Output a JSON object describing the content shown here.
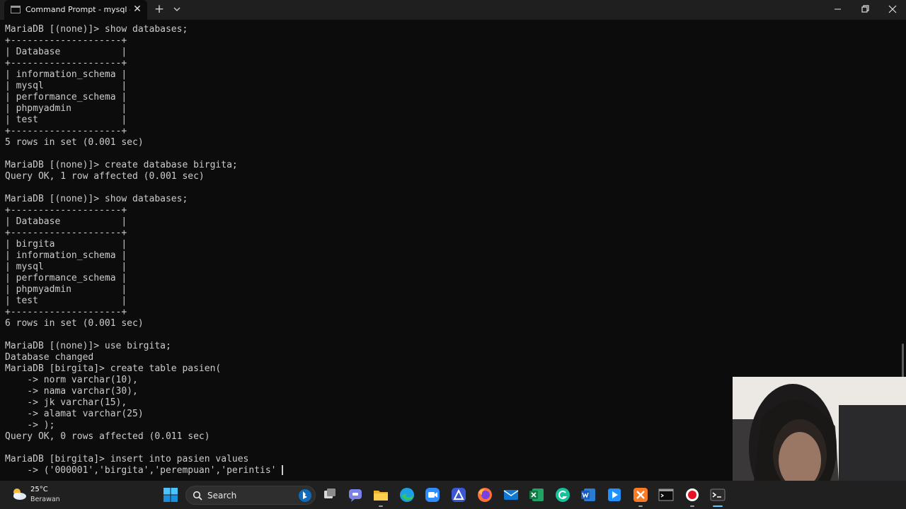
{
  "window": {
    "tab_title": "Command Prompt - mysql -u",
    "tab_close": "✕",
    "new_tab": "+"
  },
  "terminal": {
    "lines": [
      "MariaDB [(none)]> show databases;",
      "+--------------------+",
      "| Database           |",
      "+--------------------+",
      "| information_schema |",
      "| mysql              |",
      "| performance_schema |",
      "| phpmyadmin         |",
      "| test               |",
      "+--------------------+",
      "5 rows in set (0.001 sec)",
      "",
      "MariaDB [(none)]> create database birgita;",
      "Query OK, 1 row affected (0.001 sec)",
      "",
      "MariaDB [(none)]> show databases;",
      "+--------------------+",
      "| Database           |",
      "+--------------------+",
      "| birgita            |",
      "| information_schema |",
      "| mysql              |",
      "| performance_schema |",
      "| phpmyadmin         |",
      "| test               |",
      "+--------------------+",
      "6 rows in set (0.001 sec)",
      "",
      "MariaDB [(none)]> use birgita;",
      "Database changed",
      "MariaDB [birgita]> create table pasien(",
      "    -> norm varchar(10),",
      "    -> nama varchar(30),",
      "    -> jk varchar(15),",
      "    -> alamat varchar(25)",
      "    -> );",
      "Query OK, 0 rows affected (0.011 sec)",
      "",
      "MariaDB [birgita]> insert into pasien values",
      "    -> ('000001','birgita','perempuan','perintis'"
    ]
  },
  "taskbar": {
    "weather_temp": "25°C",
    "weather_desc": "Berawan",
    "search_label": "Search",
    "apps": [
      {
        "name": "start-button",
        "icon": "windows-logo-icon"
      },
      {
        "name": "task-view-button",
        "icon": "task-view-icon"
      },
      {
        "name": "teams-chat-button",
        "icon": "teams-chat-icon"
      },
      {
        "name": "file-explorer-button",
        "icon": "folder-icon"
      },
      {
        "name": "edge-button",
        "icon": "edge-icon"
      },
      {
        "name": "zoom-button",
        "icon": "zoom-icon"
      },
      {
        "name": "affinity-button",
        "icon": "affinity-icon"
      },
      {
        "name": "firefox-button",
        "icon": "firefox-icon"
      },
      {
        "name": "mail-button",
        "icon": "mail-icon"
      },
      {
        "name": "excel-button",
        "icon": "excel-icon"
      },
      {
        "name": "grammarly-button",
        "icon": "grammarly-icon"
      },
      {
        "name": "word-button",
        "icon": "word-icon"
      },
      {
        "name": "media-player-button",
        "icon": "media-player-icon"
      },
      {
        "name": "xampp-button",
        "icon": "xampp-icon"
      },
      {
        "name": "command-prompt-button",
        "icon": "command-prompt-icon"
      },
      {
        "name": "screen-recorder-button",
        "icon": "record-icon"
      },
      {
        "name": "terminal-button",
        "icon": "terminal-icon"
      }
    ]
  },
  "colors": {
    "terminal_bg": "#0c0c0c",
    "terminal_fg": "#cccccc",
    "titlebar_bg": "#1f1f1f",
    "taskbar_bg": "#202020"
  }
}
